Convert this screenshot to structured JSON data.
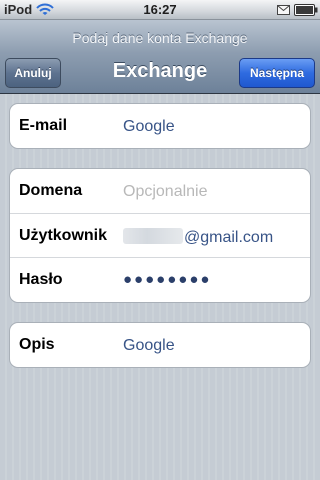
{
  "status_bar": {
    "carrier": "iPod",
    "time": "16:27",
    "icons": [
      "wifi-icon",
      "mail-icon",
      "battery-icon"
    ]
  },
  "nav_bar": {
    "prompt": "Podaj dane konta Exchange",
    "title": "Exchange",
    "cancel_label": "Anuluj",
    "next_label": "Następna",
    "next_color": "#2f6be0"
  },
  "form": {
    "email": {
      "label": "E-mail",
      "value": "Google"
    },
    "domain": {
      "label": "Domena",
      "value": "",
      "placeholder": "Opcjonalnie"
    },
    "username": {
      "label": "Użytkownik",
      "value_suffix": "@gmail.com"
    },
    "password": {
      "label": "Hasło",
      "masked_value": "●●●●●●●●"
    },
    "description": {
      "label": "Opis",
      "value": "Google"
    }
  }
}
